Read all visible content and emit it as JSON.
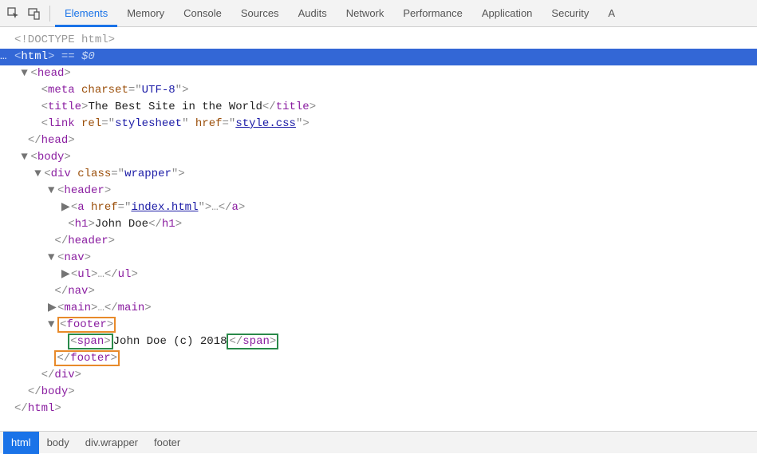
{
  "tabs": [
    "Elements",
    "Memory",
    "Console",
    "Sources",
    "Audits",
    "Network",
    "Performance",
    "Application",
    "Security",
    "A"
  ],
  "active_tab": "Elements",
  "dom": {
    "doctype": "<!DOCTYPE html>",
    "html_open": "html",
    "html_selected_suffix": "$0",
    "head": {
      "tag": "head",
      "meta": {
        "attr": "charset",
        "val": "UTF-8"
      },
      "title": {
        "text": "The Best Site in the World"
      },
      "link": {
        "rel": "stylesheet",
        "href_attr": "href",
        "href_val": "style.css"
      }
    },
    "body": {
      "tag": "body",
      "div": {
        "tag": "div",
        "class_attr": "class",
        "class_val": "wrapper"
      },
      "header": {
        "tag": "header",
        "a": {
          "href_attr": "href",
          "href_val": "index.html"
        },
        "h1": {
          "text": "John Doe"
        }
      },
      "nav": {
        "tag": "nav",
        "ul": "ul"
      },
      "main": {
        "tag": "main"
      },
      "footer": {
        "tag": "footer",
        "span_tag": "span",
        "span_text": "John Doe (c) 2018"
      }
    }
  },
  "breadcrumb": [
    "html",
    "body",
    "div.wrapper",
    "footer"
  ],
  "active_crumb": "html"
}
